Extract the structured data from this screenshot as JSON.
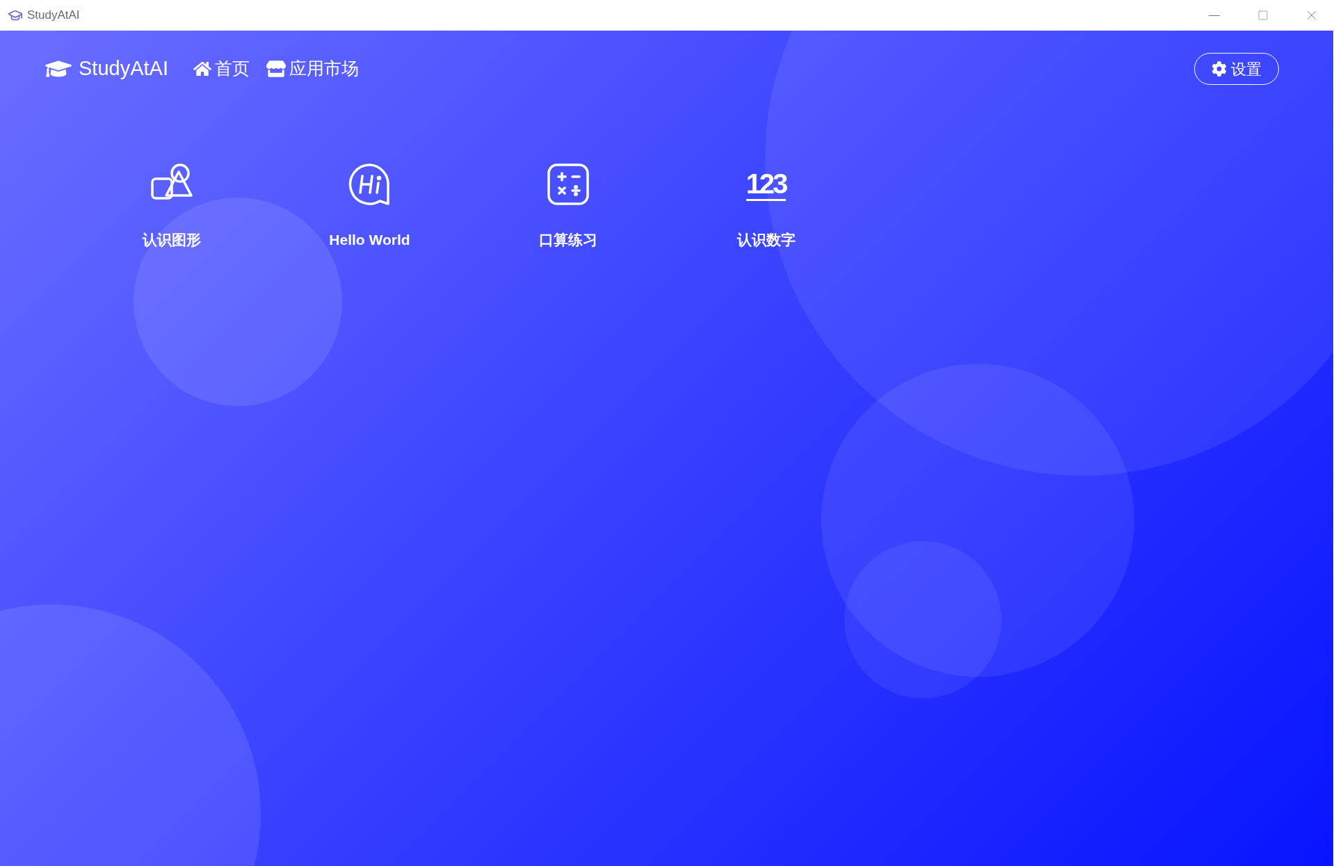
{
  "window": {
    "title": "StudyAtAI"
  },
  "nav": {
    "brand": "StudyAtAI",
    "items": [
      {
        "label": "首页",
        "kind": "home"
      },
      {
        "label": "应用市场",
        "kind": "store"
      }
    ]
  },
  "settings_button": {
    "label": "设置"
  },
  "apps": [
    {
      "label": "认识图形",
      "kind": "shapes"
    },
    {
      "label": "Hello World",
      "kind": "hi"
    },
    {
      "label": "口算练习",
      "kind": "calc"
    },
    {
      "label": "认识数字",
      "kind": "numbers",
      "icon_text": "123"
    }
  ]
}
